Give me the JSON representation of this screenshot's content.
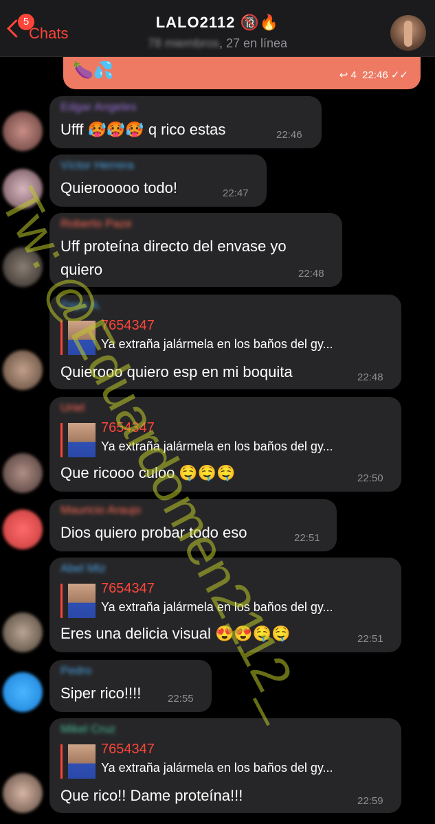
{
  "header": {
    "back_label": "Chats",
    "unread_badge": "5",
    "title": "LALO2112 🔞🔥",
    "members_blurred": "78 miembros",
    "online": ", 27 en línea"
  },
  "own_message": {
    "emoji": "🍆💦",
    "replies": "↩ 4",
    "time": "22:46 ✓✓"
  },
  "messages": [
    {
      "sender": "Edgar Angeles",
      "text": "Ufff 🥵🥵🥵 q rico estas",
      "time": "22:46"
    },
    {
      "sender": "Víctor Herrera",
      "text": "Quierooooo todo!",
      "time": "22:47"
    },
    {
      "sender": "Roberto Paze",
      "text": "Uff proteína directo del envase yo",
      "text2": "quiero",
      "time": "22:48"
    },
    {
      "sender": "Pepe A.",
      "reply_name": "7654347",
      "reply_text": "Ya extraña jalármela en los baños del gy...",
      "text": "Quierooo quiero esp en mi boquita",
      "time": "22:48"
    },
    {
      "sender": "Uriel",
      "reply_name": "7654347",
      "reply_text": "Ya extraña jalármela en los baños del gy...",
      "text": "Que ricooo culoo 🤤🤤🤤",
      "time": "22:50"
    },
    {
      "sender": "Mauricio Araujo",
      "text": "Dios quiero probar todo eso",
      "time": "22:51"
    },
    {
      "sender": "Abel Mtz",
      "reply_name": "7654347",
      "reply_text": "Ya extraña jalármela en los baños del gy...",
      "text": "Eres una delicia visual 😍😍🤤🤤",
      "time": "22:51"
    },
    {
      "sender": "Pedro",
      "text": "Siper rico!!!!",
      "time": "22:55"
    },
    {
      "sender": "Mikel Cruz",
      "reply_name": "7654347",
      "reply_text": "Ya extraña jalármela en los baños del gy...",
      "text": "Que rico!! Dame proteína!!!",
      "time": "22:59"
    }
  ],
  "watermark": "Tw: @Eduardomen2112_",
  "colors": {
    "accent": "#ff453a",
    "bubble": "#262628",
    "own_bubble": "#ee7a63",
    "watermark": "#bec828"
  }
}
